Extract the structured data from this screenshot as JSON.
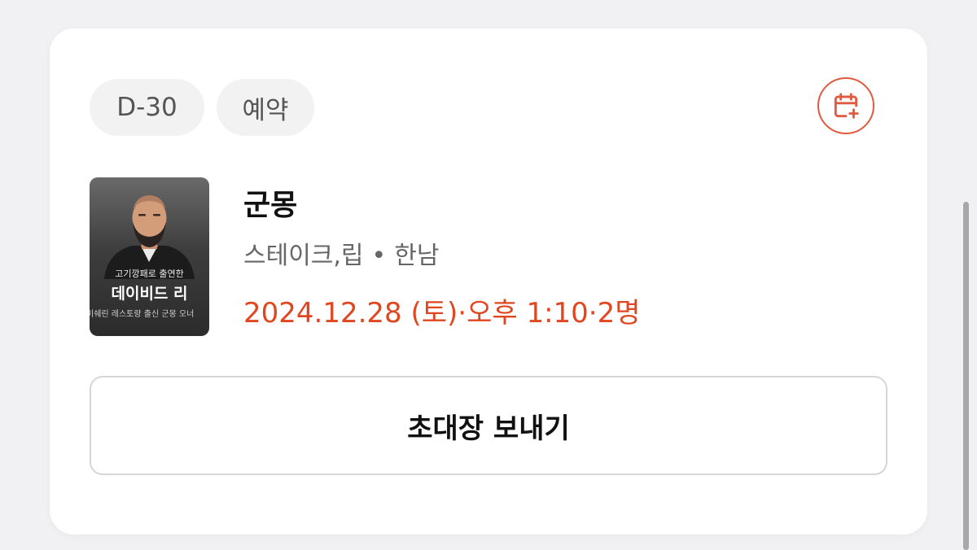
{
  "badges": {
    "dday": "D-30",
    "status": "예약"
  },
  "calendar_icon": "calendar-plus-icon",
  "restaurant": {
    "name": "군몽",
    "category": "스테이크,립",
    "separator": "•",
    "area": "한남",
    "thumbnail": {
      "line1": "고기깡패로 출연한",
      "line2": "데이비드 리",
      "line3": "미쉐린 레스토랑 출신 군몽 오너"
    }
  },
  "reservation": {
    "datetime": "2024.12.28 (토)·오후 1:10·2명"
  },
  "actions": {
    "invite_label": "초대장 보내기"
  },
  "colors": {
    "accent": "#e0461f",
    "chip_bg": "#f2f2f2"
  }
}
